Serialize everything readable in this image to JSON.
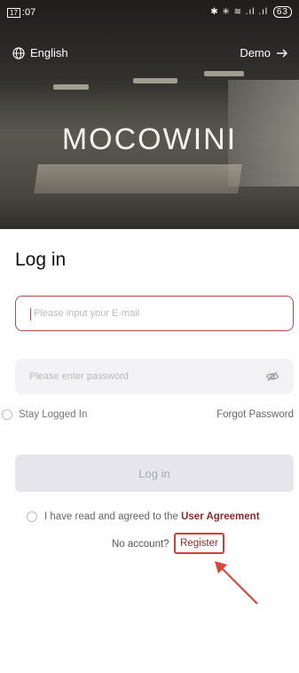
{
  "status_bar": {
    "time": "07",
    "icons": "✱ ✳ ≋ .ıl .ıl",
    "battery": "63"
  },
  "header": {
    "language": "English",
    "demo": "Demo"
  },
  "brand": {
    "logo": "MOCOWINI"
  },
  "login": {
    "title": "Log in",
    "email_placeholder": "Please input your E-mail",
    "password_placeholder": "Please enter password",
    "stay_logged_in": "Stay Logged In",
    "forgot_password": "Forgot Password",
    "login_button": "Log in",
    "agreement_text": "I have read and agreed to the",
    "agreement_link": "User Agreement",
    "no_account": "No account?",
    "register": "Register"
  },
  "colors": {
    "accent": "#8e2b2b",
    "highlight": "#d83a3a",
    "button_disabled": "#e6e6ec"
  },
  "icons": {
    "language": "globe-icon",
    "demo": "arrow-right-icon",
    "password_toggle": "eye-off-icon",
    "annotation": "red-arrow-icon"
  }
}
